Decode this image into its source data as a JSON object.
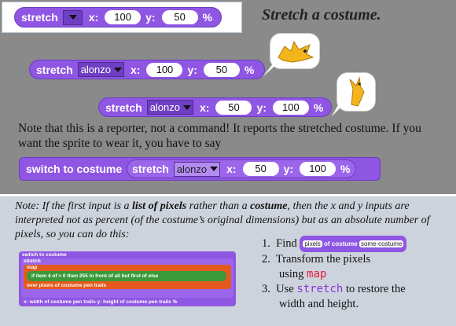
{
  "header": {
    "title": "Stretch a costume."
  },
  "block1": {
    "label": "stretch",
    "x_label": "x:",
    "x_val": "100",
    "y_label": "y:",
    "y_val": "50",
    "pct": "%"
  },
  "block2": {
    "label": "stretch",
    "costume": "alonzo",
    "x_label": "x:",
    "x_val": "100",
    "y_label": "y:",
    "y_val": "50",
    "pct": "%"
  },
  "block3": {
    "label": "stretch",
    "costume": "alonzo",
    "x_label": "x:",
    "x_val": "50",
    "y_label": "y:",
    "y_val": "100",
    "pct": "%"
  },
  "note": "Note that this is a reporter, not a command!  It reports the stretched costume.  If you want the sprite to wear it, you have to say",
  "switch": {
    "label": "switch to costume",
    "inner": "stretch",
    "costume": "alonzo",
    "x_label": "x:",
    "x_val": "50",
    "y_label": "y:",
    "y_val": "100",
    "pct": "%"
  },
  "note2": {
    "p1": "Note:  If the first input is a ",
    "b1": "list of pixels",
    "p2": " rather than a ",
    "b2": "costume",
    "p3": ", then the x and y inputs are interpreted not as percent (of the costume’s original dimensions) but as an absolute number of pixels, so you can do this:"
  },
  "steps": {
    "s1_num": "1.",
    "s1_text": "Find",
    "s1_block_a": "pixels",
    "s1_block_b": "of costume",
    "s1_block_c": "some-costume",
    "s2_num": "2.",
    "s2_text": "Transform the pixels",
    "s2_text2": "using",
    "s2_code": "map",
    "s3_num": "3.",
    "s3_text": "Use",
    "s3_code": "stretch",
    "s3_text2": "to restore the",
    "s3_text3": "width and height."
  },
  "script": {
    "l1": "switch to costume",
    "l2": "stretch",
    "l3": "map",
    "l4": "if  item 4 of  > 0  then  255  in front of  all but first of  else",
    "l5": "over  pixels  of costume  pen trails",
    "l6": "x:  width  of costume  pen trails   y:  height  of costume  pen trails  %"
  }
}
